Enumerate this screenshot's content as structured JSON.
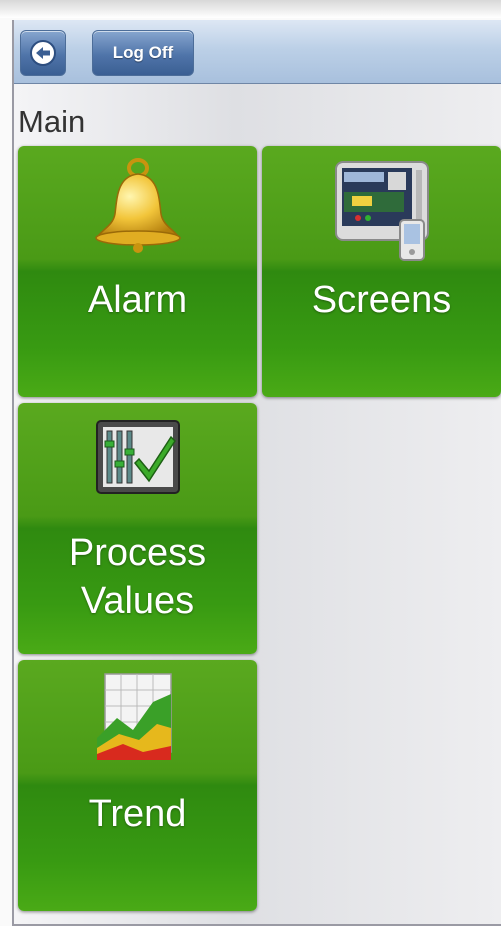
{
  "toolbar": {
    "back_icon": "back-arrow-icon",
    "logoff_label": "Log Off"
  },
  "page": {
    "title": "Main"
  },
  "tiles": [
    {
      "id": "alarm",
      "label": "Alarm",
      "icon": "bell-icon"
    },
    {
      "id": "screens",
      "label": "Screens",
      "icon": "screens-device-icon"
    },
    {
      "id": "process-values",
      "label_line1": "Process",
      "label_line2": "Values",
      "icon": "sliders-check-icon"
    },
    {
      "id": "trend",
      "label": "Trend",
      "icon": "trend-chart-icon"
    }
  ],
  "colors": {
    "tile_green": "#4a9a16",
    "toolbar_blue": "#bcd0e7",
    "button_blue": "#4f74a9"
  }
}
